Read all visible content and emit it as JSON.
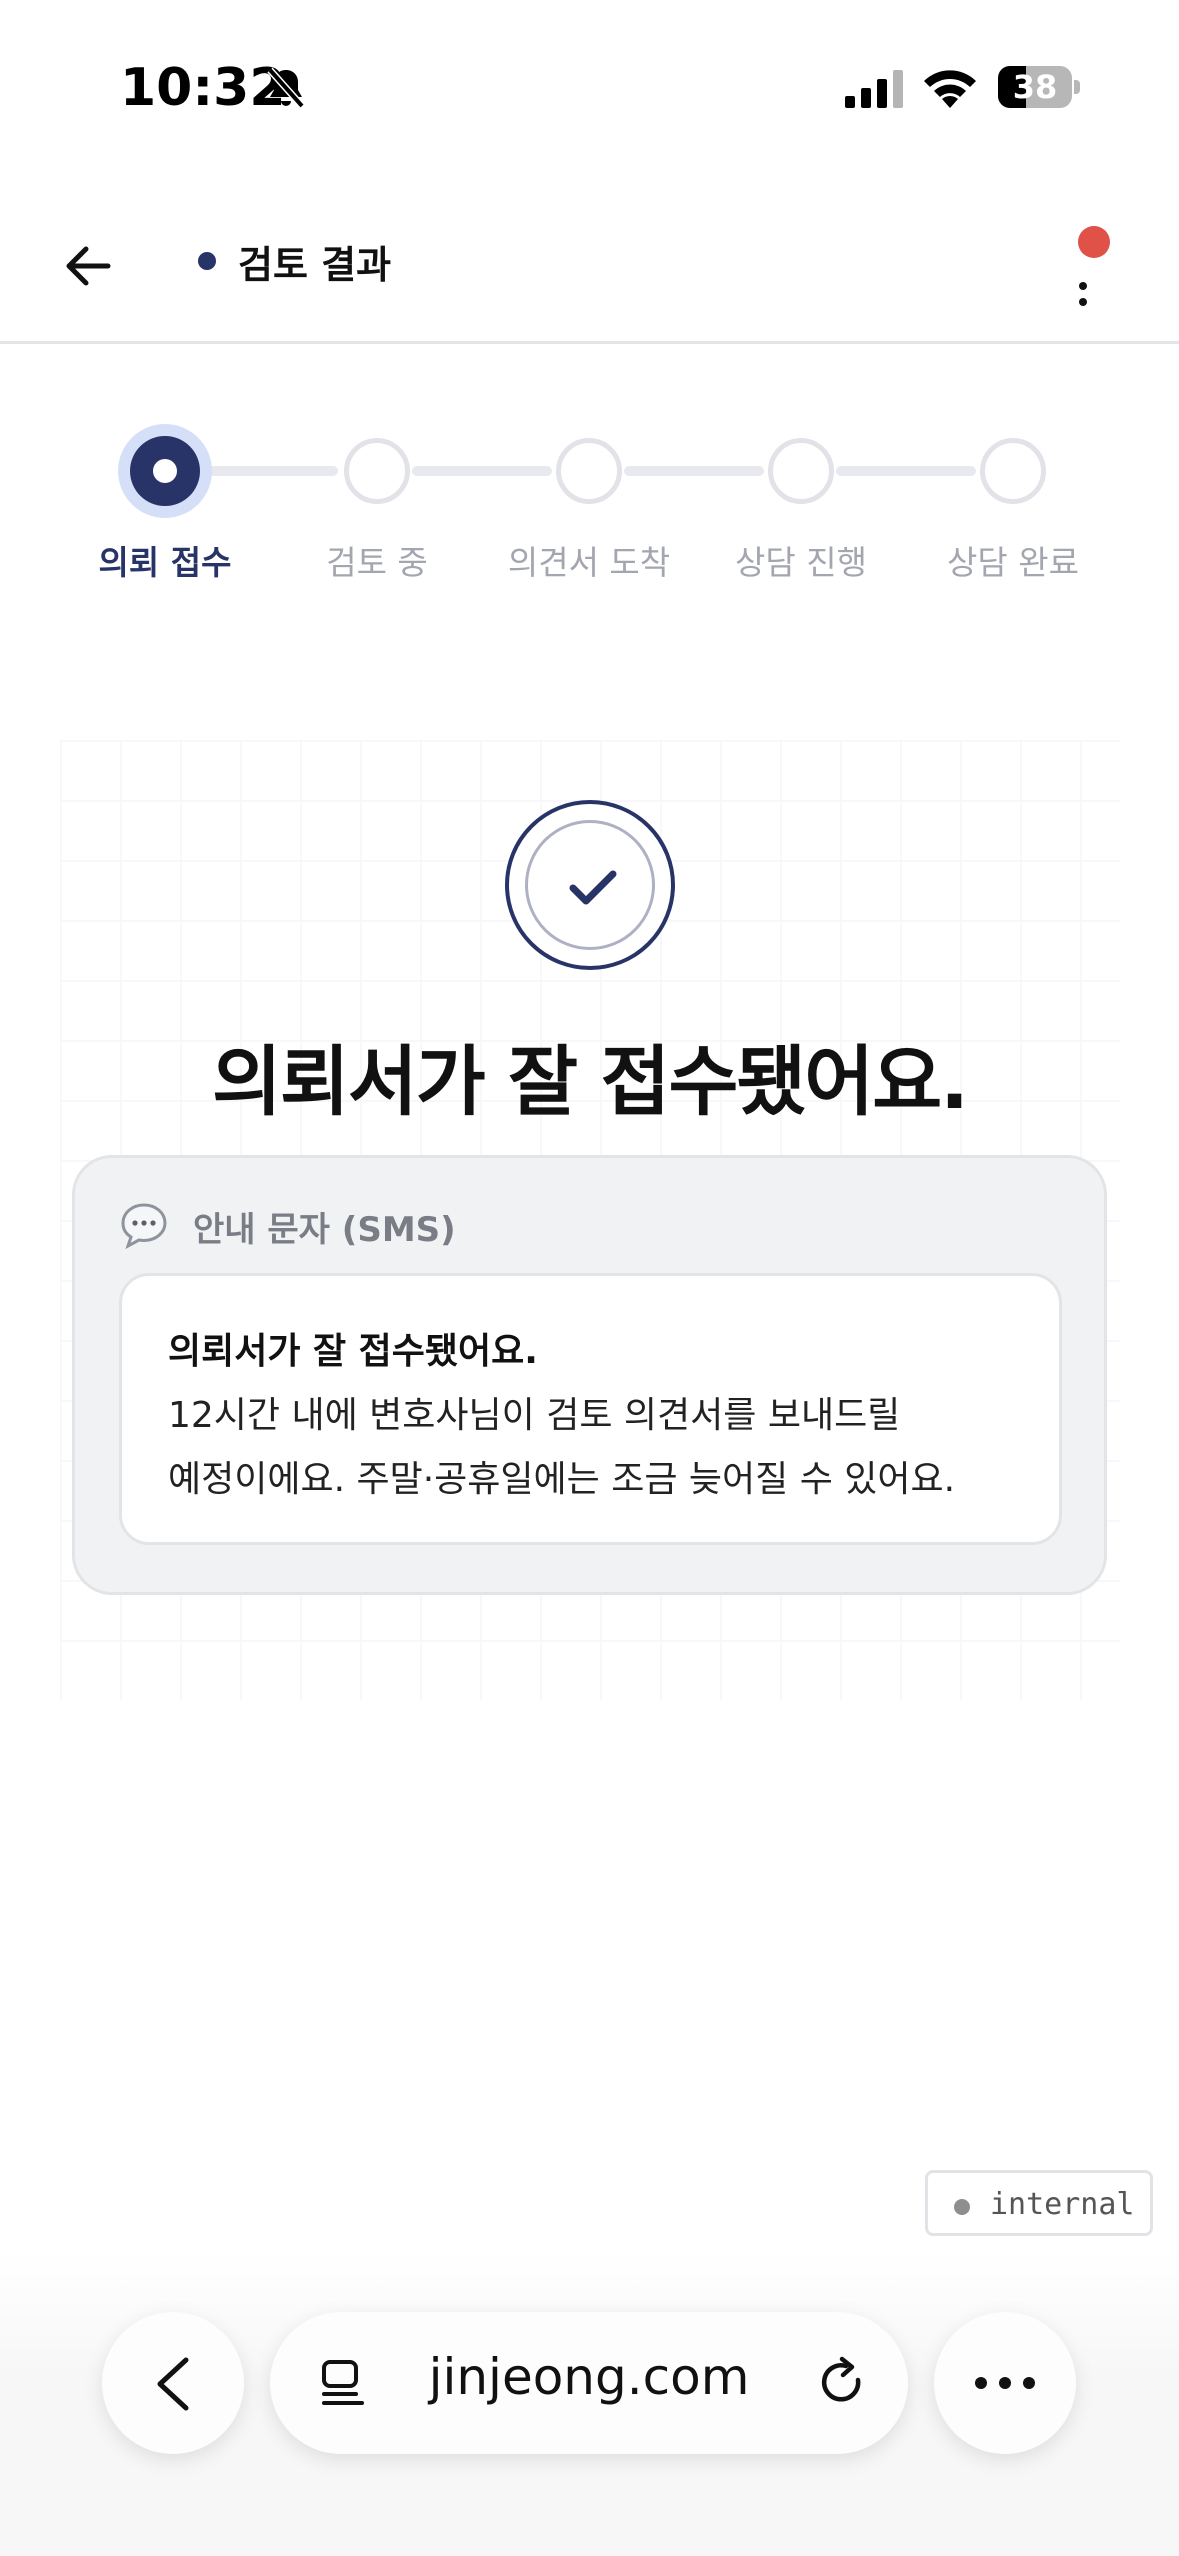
{
  "status_bar": {
    "time": "10:32",
    "battery_level": "38",
    "battery_percent": 38,
    "icons": [
      "bell-slash-icon",
      "cellular-signal-icon",
      "wifi-icon",
      "battery-icon"
    ]
  },
  "header": {
    "title": "검토 결과",
    "accent_color": "#283368",
    "notification_color": "#e05248",
    "icons": [
      "back-arrow-icon",
      "more-vertical-icon"
    ]
  },
  "stepper": {
    "active_index": 0,
    "steps": [
      {
        "label": "의뢰 접수",
        "state": "active"
      },
      {
        "label": "검토 중",
        "state": "pending"
      },
      {
        "label": "의견서 도착",
        "state": "pending"
      },
      {
        "label": "상담 진행",
        "state": "pending"
      },
      {
        "label": "상담 완료",
        "state": "pending"
      }
    ]
  },
  "hero": {
    "icon": "check-circle-icon",
    "title": "의뢰서가 잘 접수됐어요."
  },
  "sms_card": {
    "icon": "chat-bubble-icon",
    "label": "안내 문자 (SMS)",
    "message_title": "의뢰서가 잘 접수됐어요.",
    "message_line1": "12시간 내에 변호사님이 검토 의견서를 보내드릴",
    "message_line2": "예정이에요. 주말·공휴일에는 조금 늦어질 수 있어요."
  },
  "internal_badge": {
    "label": "internal"
  },
  "browser": {
    "url": "jinjeong.com",
    "icons": [
      "chevron-left-icon",
      "tabs-icon",
      "reload-icon",
      "more-horizontal-icon"
    ]
  }
}
